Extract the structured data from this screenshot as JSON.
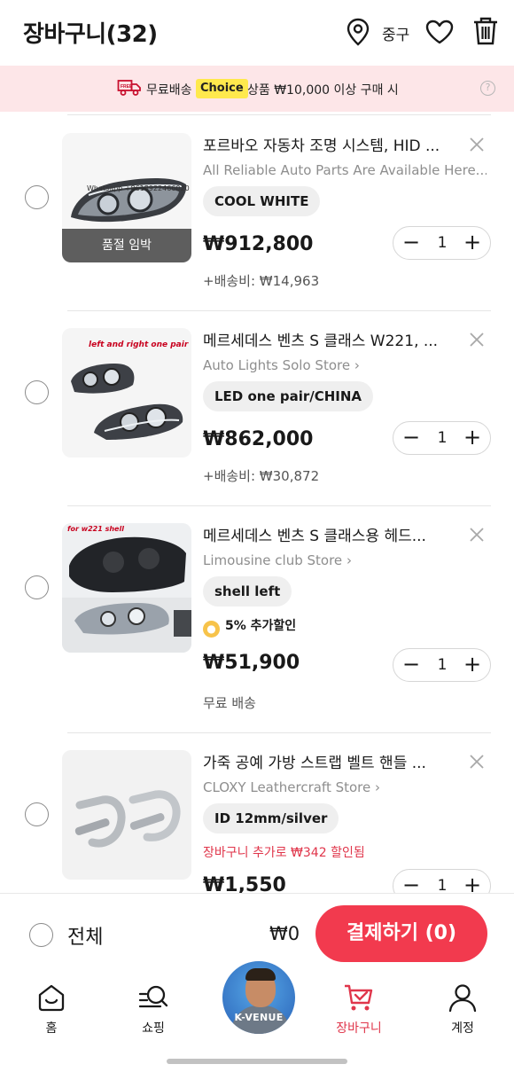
{
  "header": {
    "title": "장바구니(32)",
    "location": "중구",
    "icons": [
      "location-pin-icon",
      "heart-icon",
      "trash-icon"
    ]
  },
  "promo": {
    "text_before": "무료배송",
    "badge": "Choice",
    "text_after": "상품 ₩10,000 이상 구매 시",
    "help": "?"
  },
  "items": [
    {
      "name": "포르바오 자동차 조명 시스템, HID ...",
      "store": "All Reliable Auto Parts Are Available Here...",
      "sku": "COOL WHITE",
      "price": "₩912,800",
      "shipping": "+배송비: ₩14,963",
      "quantity": "1",
      "sold_out_label": "품절 임박",
      "image_label": "Whatsapp +8618922466020"
    },
    {
      "name": "메르세데스 벤츠 S 클래스 W221, ...",
      "store": "Auto Lights Solo Store",
      "sku": "LED one pair/CHINA",
      "price": "₩862,000",
      "shipping": "+배송비: ₩30,872",
      "quantity": "1",
      "image_label": "left and right one pair"
    },
    {
      "name": "메르세데스 벤츠 S 클래스용 헤드...",
      "store": "Limousine club Store",
      "sku": "shell left",
      "discount": "5% 추가할인",
      "price": "₩51,900",
      "shipping": "무료 배송",
      "quantity": "1",
      "image_label": "for w221 shell"
    },
    {
      "name": "가죽 공예 가방 스트랩 벨트 핸들 ...",
      "store": "CLOXY Leathercraft Store",
      "sku": "ID 12mm/silver",
      "promo": "장바구니 추가로 ₩342 할인됨",
      "price": "₩1,550",
      "quantity": "1"
    }
  ],
  "checkout": {
    "select_all_label": "전체",
    "total": "₩0",
    "pay_button": "결제하기 (0)"
  },
  "tabbar": {
    "tabs": [
      {
        "label": "홈",
        "icon": "home-icon"
      },
      {
        "label": "쇼핑",
        "icon": "shopping-search-icon"
      },
      {
        "label": "K-VENUE",
        "icon": "k-venue-badge"
      },
      {
        "label": "장바구니",
        "icon": "cart-icon",
        "active": true
      },
      {
        "label": "계정",
        "icon": "account-icon"
      }
    ]
  },
  "colors": {
    "accent": "#f23a4e",
    "promo_bg": "#fde6e8",
    "choice_badge": "#ffe94d"
  }
}
